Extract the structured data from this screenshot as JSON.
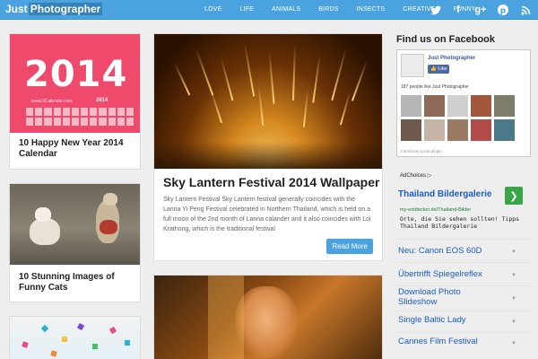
{
  "header": {
    "logo_part1": "Just",
    "logo_part2": "Photographer",
    "nav": [
      "LOVE",
      "LIFE",
      "ANIMALS",
      "BIRDS",
      "INSECTS",
      "CREATIVE",
      "FUNNY"
    ],
    "social": [
      "twitter-icon",
      "facebook-icon",
      "google-plus-icon",
      "pinterest-icon",
      "rss-icon"
    ]
  },
  "left_cards": [
    {
      "title": "10 Happy New Year 2014 Calendar",
      "image": {
        "big": "2014",
        "url": "www.9Calendar.com",
        "small_year": "2014"
      }
    },
    {
      "title": "10 Stunning Images of Funny Cats"
    },
    {
      "title": ""
    }
  ],
  "main_posts": [
    {
      "title": "Sky Lantern Festival 2014 Wallpaper",
      "excerpt": "Sky Lantern Festival Sky Lantern festival generally coincides with the Lanna Yi Peng Festival celebrated in Northern Thailand, which is held on a full moon of the 2nd month of Lanna calander and it also coincides with Loi Krathong, which is the traditional festival",
      "read_more": "Read More"
    },
    {
      "title": ""
    }
  ],
  "sidebar": {
    "heading": "Find us on Facebook",
    "facebook": {
      "page_name": "Just Photographer",
      "like_label": "Like",
      "count_text": "187 people like Just Photographer",
      "plugin_text": "Facebook social plugin"
    },
    "ad": {
      "choices": "AdChoices",
      "title": "Thailand Bildergalerie",
      "url": "my-entdecker.de/Thailand-Bilder",
      "desc": "Orte, die Sie sehen sollten! Tipps Thailand Bildergalerie"
    },
    "links": [
      "Neu: Canon EOS 60D",
      "Übertrifft Spiegelreflex",
      "Download Photo Slideshow",
      "Single Baltic Lady",
      "Cannes Film Festival"
    ]
  },
  "colors": {
    "header": "#4aa3df",
    "link": "#1a5dc9",
    "ad_button": "#38a646"
  }
}
